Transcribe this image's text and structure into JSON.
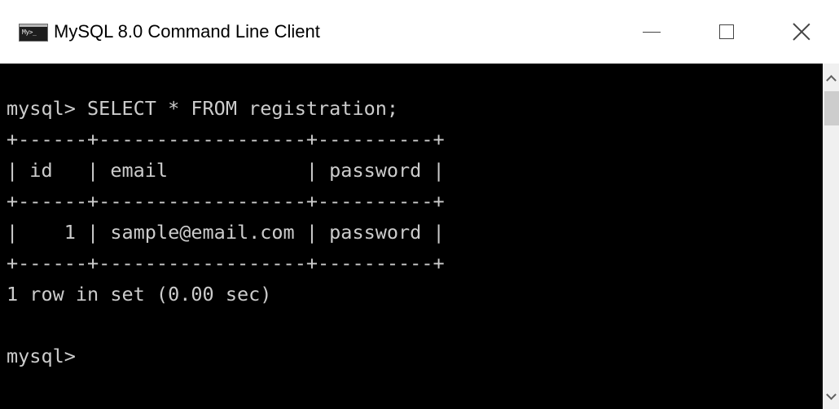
{
  "window": {
    "title": "MySQL 8.0 Command Line Client",
    "icon": "mysql-console-icon",
    "icon_text": "My>_",
    "controls": {
      "minimize": "minimize-icon",
      "maximize": "maximize-icon",
      "close": "close-icon"
    }
  },
  "console": {
    "lines": [
      "mysql> SELECT * FROM registration;",
      "+------+------------------+----------+",
      "| id   | email            | password |",
      "+------+------------------+----------+",
      "|    1 | sample@email.com | password |",
      "+------+------------------+----------+",
      "1 row in set (0.00 sec)",
      "",
      "mysql>"
    ],
    "query": {
      "prompt": "mysql>",
      "statement": "SELECT * FROM registration;",
      "columns": [
        "id",
        "email",
        "password"
      ],
      "rows": [
        [
          "1",
          "sample@email.com",
          "password"
        ]
      ],
      "result_summary": "1 row in set (0.00 sec)"
    },
    "colors": {
      "background": "#000000",
      "text": "#cccccc"
    }
  },
  "scrollbar": {
    "up": "chevron-up-icon",
    "down": "chevron-down-icon"
  }
}
